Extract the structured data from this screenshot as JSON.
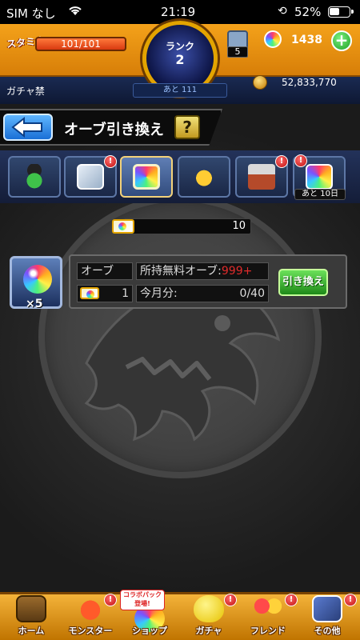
{
  "status_bar": {
    "carrier": "SIM なし",
    "time": "21:19",
    "battery": "52%"
  },
  "header": {
    "stamina_label": "スタミナ",
    "stamina": "101/101",
    "stamina_fraction": 1.0,
    "rank_label": "ランク",
    "rank": "2",
    "gift_count": "5",
    "orb_count": "1438",
    "gacha_ban": "ガチャ禁",
    "exp_remaining": "あと 111",
    "gold": "52,833,770"
  },
  "title": {
    "back_icon": "arrow-left-icon",
    "text": "オーブ引き換え",
    "help": "?"
  },
  "tabs": [
    {
      "name": "clover-tab",
      "badge": ""
    },
    {
      "name": "gift-box-tab",
      "badge": "!"
    },
    {
      "name": "orb-ticket-tab",
      "badge": ""
    },
    {
      "name": "monster-tab",
      "badge": ""
    },
    {
      "name": "castle-tab",
      "badge": "!"
    },
    {
      "name": "limited-tab",
      "badge": "!",
      "remaining": "あと 10日"
    }
  ],
  "ticket_count": "10",
  "exchange": {
    "reward_qty": "×5",
    "orb_label": "オーブ",
    "ticket_cost": "1",
    "free_orb_label": "所持無料オーブ:",
    "free_orb_value": "999+",
    "this_month_label": "今月分:",
    "this_month_value": "0/40",
    "button": "引き換え"
  },
  "bottom_nav": {
    "items": [
      {
        "label": "ホーム",
        "badge": ""
      },
      {
        "label": "モンスター",
        "badge": "!"
      },
      {
        "label": "ショップ",
        "badge": ""
      },
      {
        "label": "ガチャ",
        "badge": "!"
      },
      {
        "label": "フレンド",
        "badge": "!"
      },
      {
        "label": "その他",
        "badge": "!"
      }
    ],
    "collab_banner": "コラボパック 登場!"
  },
  "colors": {
    "header_orange": "#f4a21a",
    "accent_blue": "#1a6fd6",
    "exchange_green": "#1e8a18",
    "warning_red": "#e02b2b"
  }
}
